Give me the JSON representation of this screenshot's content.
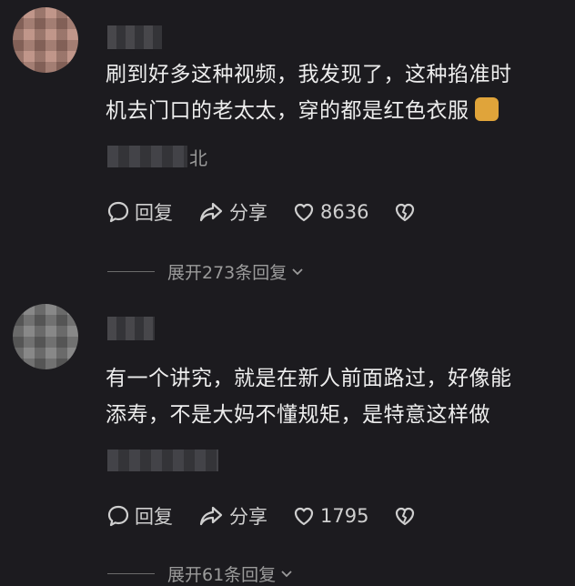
{
  "comments": [
    {
      "username": "",
      "text_line1": "刷到好多这种视频，我发现了，这种掐准时",
      "text_line2": "机去门口的老太太，穿的都是红色衣服",
      "meta_visible": "北",
      "reply_label": "回复",
      "share_label": "分享",
      "like_count": "8636",
      "expand_label": "展开273条回复"
    },
    {
      "username": "",
      "text_line1": "有一个讲究，就是在新人前面路过，好像能",
      "text_line2": "添寿，不是大妈不懂规矩，是特意这样做",
      "meta_visible": "",
      "reply_label": "回复",
      "share_label": "分享",
      "like_count": "1795",
      "expand_label": "展开61条回复"
    }
  ],
  "icons": {
    "reply": "comment-bubble-icon",
    "share": "share-arrow-icon",
    "like": "heart-outline-icon",
    "dislike": "broken-heart-icon",
    "expand": "chevron-down-icon"
  },
  "colors": {
    "background": "#1c1b1f",
    "text": "#ededed",
    "secondary": "#9b9b9b"
  }
}
